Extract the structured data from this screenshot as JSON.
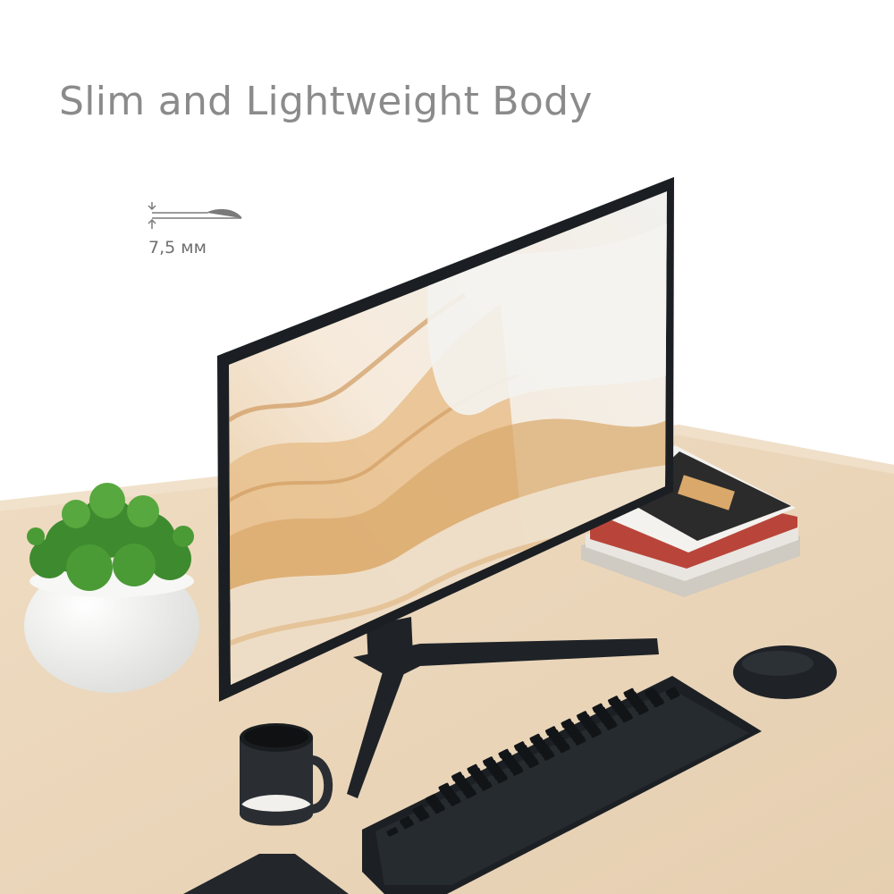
{
  "headline": "Slim and Lightweight Body",
  "thickness": {
    "value_label": "7,5 мм",
    "icon": "profile-thickness-icon"
  },
  "scene": {
    "objects": [
      "monitor",
      "monitor-stand",
      "potted-plant",
      "magazine-stack",
      "mug",
      "keyboard",
      "mouse",
      "mouse-pad",
      "desk"
    ],
    "palette": {
      "background": "#ffffff",
      "desk": "#ecd8bd",
      "device_black": "#1e2226",
      "headline_text": "#8b8b8b",
      "plant_green": "#3e8a2e",
      "pot_white": "#f2f2f0",
      "screen_sand": "#d9a86a"
    }
  }
}
